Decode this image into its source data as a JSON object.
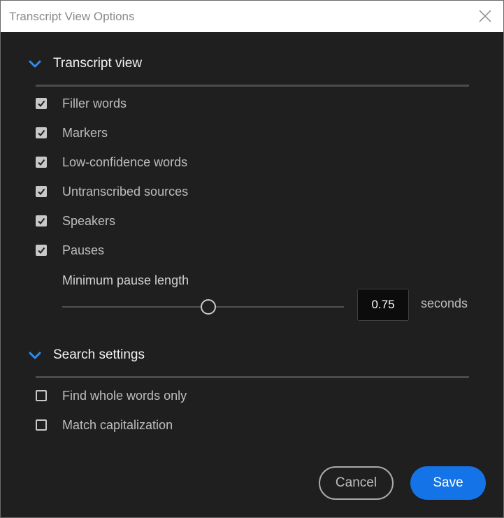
{
  "window": {
    "title": "Transcript View Options",
    "close_icon": "close-icon"
  },
  "transcript_view": {
    "label": "Transcript view",
    "expanded": true,
    "options": [
      {
        "label": "Filler words",
        "checked": true
      },
      {
        "label": "Markers",
        "checked": true
      },
      {
        "label": "Low-confidence words",
        "checked": true
      },
      {
        "label": "Untranscribed sources",
        "checked": true
      },
      {
        "label": "Speakers",
        "checked": true
      },
      {
        "label": "Pauses",
        "checked": true
      }
    ],
    "min_pause": {
      "label": "Minimum pause length",
      "value": "0.75",
      "unit": "seconds",
      "slider_fraction": 0.5
    }
  },
  "search_settings": {
    "label": "Search settings",
    "expanded": true,
    "options": [
      {
        "label": "Find whole words only",
        "checked": false
      },
      {
        "label": "Match capitalization",
        "checked": false
      }
    ]
  },
  "buttons": {
    "cancel": "Cancel",
    "save": "Save"
  },
  "colors": {
    "accent": "#1473e6",
    "background": "#1f1f1f",
    "chevron": "#2d8ceb"
  }
}
